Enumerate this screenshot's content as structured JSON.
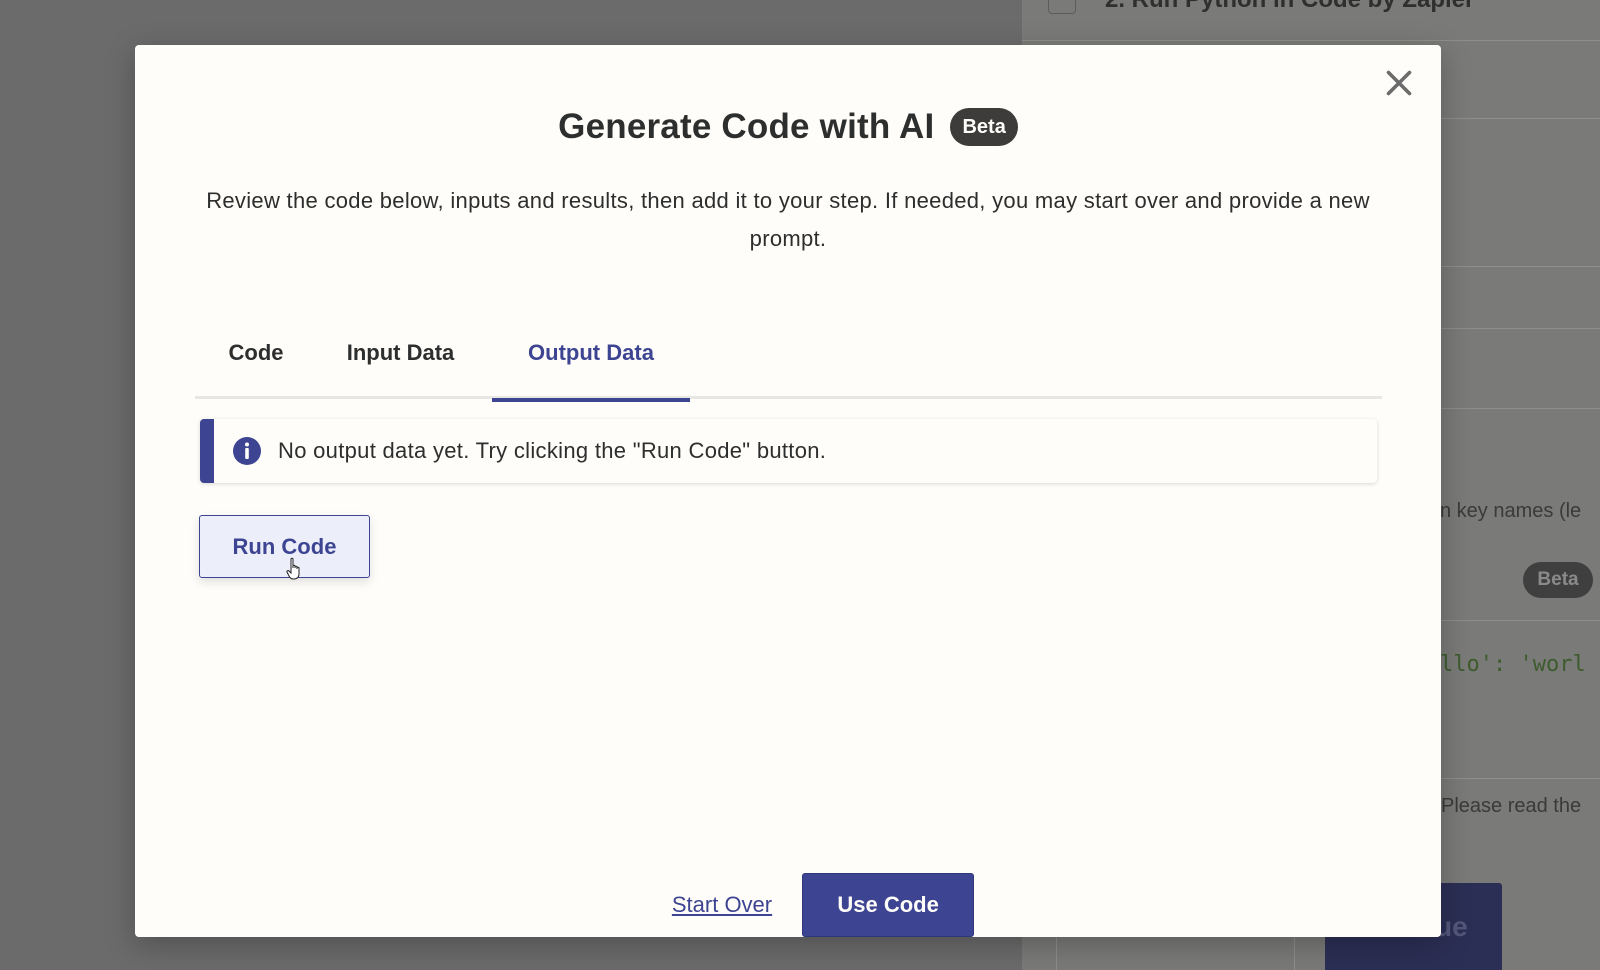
{
  "background": {
    "step_title": "2. Run Python in Code by Zapier",
    "partial_text_1": "n key names (le",
    "partial_text_2": "Please read the",
    "code_snippet": "llo': 'worl",
    "beta_badge": "Beta",
    "continue_label": "ue"
  },
  "modal": {
    "title": "Generate Code with AI",
    "badge": "Beta",
    "subtitle": "Review the code below, inputs and results, then add it to your step. If needed, you may start over and provide a new prompt.",
    "tabs": [
      {
        "label": "Code"
      },
      {
        "label": "Input Data"
      },
      {
        "label": "Output Data",
        "active": true
      }
    ],
    "alert": {
      "icon": "info-icon",
      "text": "No output data yet. Try clicking the \"Run Code\" button."
    },
    "run_button_label": "Run Code",
    "footer": {
      "start_over_label": "Start Over",
      "use_code_label": "Use Code"
    },
    "close_icon": "close-icon"
  },
  "colors": {
    "accent": "#3d4592",
    "modal_bg": "#fffdf9",
    "text": "#2d2e2e",
    "badge_bg": "#3d3c3b",
    "overlay": "#6b6b6b"
  }
}
